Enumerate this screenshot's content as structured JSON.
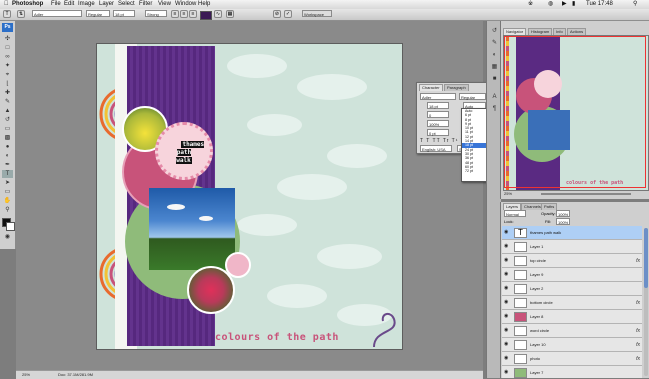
{
  "menubar": {
    "app_name": "Photoshop",
    "menus": [
      "File",
      "Edit",
      "Image",
      "Layer",
      "Select",
      "Filter",
      "View",
      "Window",
      "Help"
    ],
    "clock": "Tue 17:48"
  },
  "options": {
    "font_family": "Adler",
    "font_style": "Regular",
    "font_size": "18 pt",
    "antialias": "Strong",
    "workspace": "Workspace"
  },
  "canvas": {
    "title_text": "thames\npath\nwalk",
    "bottom_text": "colours of the path"
  },
  "status": {
    "zoom": "25%",
    "doc": "Doc: 37.1M/281.9M"
  },
  "character_panel": {
    "tabs": [
      "Character",
      "Paragraph"
    ],
    "font_family": "Adler",
    "font_style": "Regular",
    "size": "18 pt",
    "leading": "Auto",
    "kerning": "0",
    "tracking": "0",
    "scale": "100%",
    "baseline": "0 pt",
    "language": "English: USA",
    "sharp": "Strong",
    "size_options": [
      "Auto",
      "6 pt",
      "8 pt",
      "9 pt",
      "10 pt",
      "11 pt",
      "12 pt",
      "14 pt",
      "18 pt",
      "24 pt",
      "30 pt",
      "36 pt",
      "48 pt",
      "60 pt",
      "72 pt"
    ]
  },
  "navigator": {
    "tabs": [
      "Navigator",
      "Histogram",
      "Info",
      "Actions"
    ],
    "zoom": "25%"
  },
  "layers_panel": {
    "tabs": [
      "Layers",
      "Channels",
      "Paths"
    ],
    "blend_mode": "Normal",
    "opacity_label": "Opacity:",
    "opacity": "100%",
    "lock_label": "Lock:",
    "fill_label": "Fill:",
    "fill": "100%",
    "layers": [
      {
        "name": "thames path walk",
        "type": "text",
        "selected": true,
        "fx": false
      },
      {
        "name": "Layer 1",
        "type": "img",
        "fx": false
      },
      {
        "name": "top circle",
        "type": "img",
        "fx": true
      },
      {
        "name": "Layer 9",
        "type": "img",
        "fx": false
      },
      {
        "name": "Layer 2",
        "type": "img",
        "fx": false
      },
      {
        "name": "bottom circle",
        "type": "img",
        "fx": true
      },
      {
        "name": "Layer 8",
        "type": "pink",
        "fx": false
      },
      {
        "name": "word circle",
        "type": "img",
        "fx": true
      },
      {
        "name": "Layer 10",
        "type": "img",
        "fx": true
      },
      {
        "name": "photo",
        "type": "img",
        "fx": true
      },
      {
        "name": "Layer 7",
        "type": "green",
        "fx": false
      }
    ]
  },
  "colors": {
    "accent_purple": "#5a2a82",
    "accent_pink": "#c8537a",
    "paper_green": "#cfe3da",
    "selection_blue": "#aecff5"
  }
}
